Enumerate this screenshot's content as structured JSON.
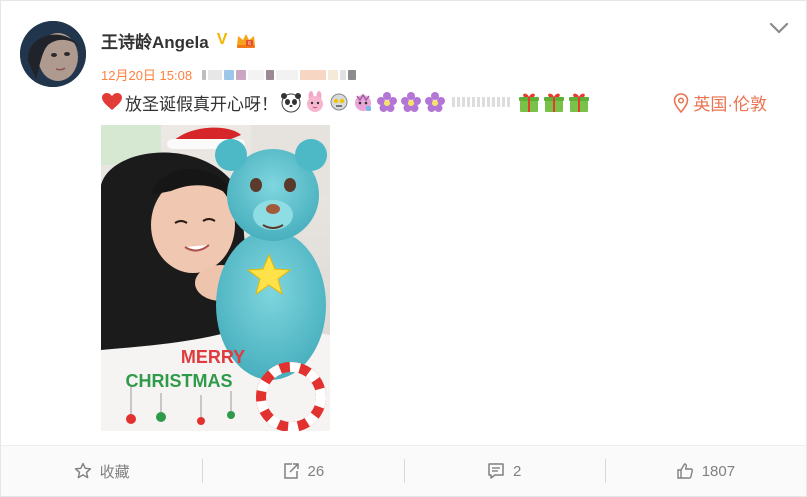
{
  "post": {
    "author": "王诗龄Angela",
    "verified_mark": "V",
    "timestamp": "12月20日 15:08",
    "text": "放圣诞假真开心呀！",
    "location": "英国·伦敦"
  },
  "photo_text": {
    "line1": "MERRY",
    "line2": "CHRISTMAS"
  },
  "actions": {
    "favorite_label": "收藏",
    "repost_count": "26",
    "comment_count": "2",
    "like_count": "1807"
  },
  "colors": {
    "accent_orange": "#ff8140",
    "location_orange": "#eb7350",
    "verified_gold": "#f4b400",
    "muted_text": "#808080"
  },
  "icons": {
    "more": "chevron-down-icon",
    "heart": "heart-icon",
    "location": "pin-icon",
    "favorite": "star-icon",
    "repost": "repost-icon",
    "comment": "comment-icon",
    "like": "thumbs-up-icon"
  }
}
